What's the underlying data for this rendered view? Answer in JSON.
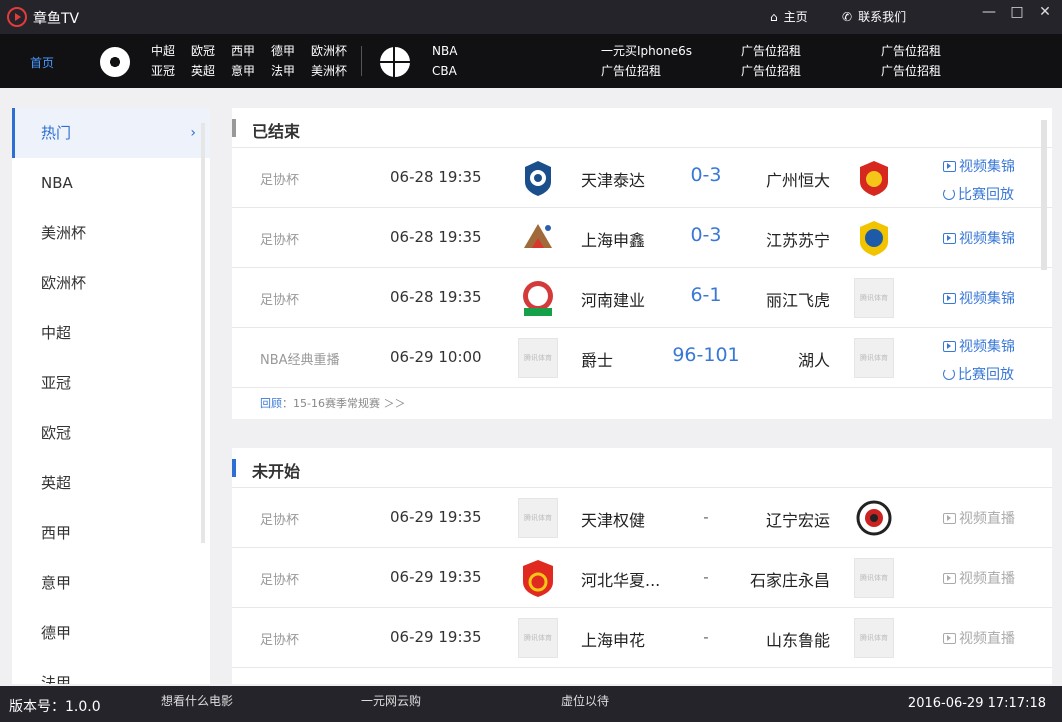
{
  "app": {
    "title": "章鱼TV",
    "home_label": "主页",
    "contact_label": "联系我们",
    "win_min": "—",
    "win_max": "□",
    "win_close": "✕"
  },
  "nav": {
    "home_tab": "首页",
    "soccer_leagues": [
      "中超",
      "欧冠",
      "西甲",
      "德甲",
      "欧洲杯",
      "亚冠",
      "英超",
      "意甲",
      "法甲",
      "美洲杯"
    ],
    "basketball_leagues": [
      "NBA",
      "CBA"
    ],
    "ads": [
      "一元买Iphone6s",
      "广告位招租",
      "广告位招租",
      "广告位招租",
      "广告位招租",
      "广告位招租"
    ]
  },
  "sidebar": {
    "items": [
      "热门",
      "NBA",
      "美洲杯",
      "欧洲杯",
      "中超",
      "亚冠",
      "欧冠",
      "英超",
      "西甲",
      "意甲",
      "德甲",
      "法甲"
    ],
    "active_index": 0
  },
  "finished": {
    "title": "已结束",
    "accent": "#999999",
    "rows": [
      {
        "league": "足协杯",
        "time": "06-28 19:35",
        "home": "天津泰达",
        "score": "0-3",
        "away": "广州恒大",
        "links": [
          "视频集锦",
          "比赛回放"
        ]
      },
      {
        "league": "足协杯",
        "time": "06-28 19:35",
        "home": "上海申鑫",
        "score": "0-3",
        "away": "江苏苏宁",
        "links": [
          "视频集锦"
        ]
      },
      {
        "league": "足协杯",
        "time": "06-28 19:35",
        "home": "河南建业",
        "score": "6-1",
        "away": "丽江飞虎",
        "links": [
          "视频集锦"
        ]
      },
      {
        "league": "NBA经典重播",
        "time": "06-29 10:00",
        "home": "爵士",
        "score": "96-101",
        "away": "湖人",
        "links": [
          "视频集锦",
          "比赛回放"
        ]
      }
    ],
    "review_label": "回顾",
    "review_text": "：15-16赛季常规赛 ＞＞"
  },
  "upcoming": {
    "title": "未开始",
    "accent": "#2d6fd2",
    "rows": [
      {
        "league": "足协杯",
        "time": "06-29 19:35",
        "home": "天津权健",
        "score": "-",
        "away": "辽宁宏运",
        "links": [
          "视频直播"
        ]
      },
      {
        "league": "足协杯",
        "time": "06-29 19:35",
        "home": "河北华夏...",
        "score": "-",
        "away": "石家庄永昌",
        "links": [
          "视频直播"
        ]
      },
      {
        "league": "足协杯",
        "time": "06-29 19:35",
        "home": "上海申花",
        "score": "-",
        "away": "山东鲁能",
        "links": [
          "视频直播"
        ]
      }
    ]
  },
  "placeholder_logo_text": "腾讯体育",
  "footer": {
    "version": "版本号：1.0.0",
    "links": [
      "想看什么电影",
      "一元网云购",
      "虚位以待"
    ],
    "datetime": "2016-06-29 17:17:18"
  }
}
